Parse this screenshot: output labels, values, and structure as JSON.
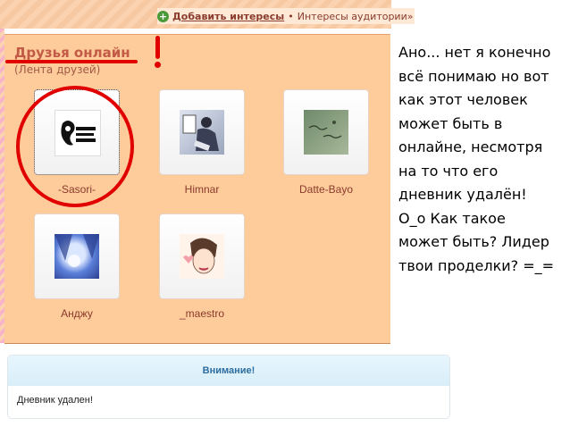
{
  "interests_bar": {
    "add_interests": "Добавить интересы",
    "separator": "•",
    "audience_interests": "Интересы аудитории»"
  },
  "friends_panel": {
    "title": "Друзья онлайн",
    "subtitle": "(Лента друзей)",
    "friends": [
      {
        "name": "-Sasori-"
      },
      {
        "name": "Himnar"
      },
      {
        "name": "Datte-Bayo"
      },
      {
        "name": "Анджу"
      },
      {
        "name": "_maestro"
      }
    ]
  },
  "annotation": {
    "exclamation": "!",
    "comment_lines": [
      "Ано... нет я конечно",
      "всё понимаю но вот",
      "как этот человек",
      "может быть в",
      "онлайне, несмотря",
      "на то что его",
      "дневник удалён!",
      "О_о Как такое",
      "может быть? Лидер",
      "твои проделки? =_="
    ],
    "color": "#e10000"
  },
  "warning": {
    "title": "Внимание!",
    "message": "Дневник удален!"
  }
}
